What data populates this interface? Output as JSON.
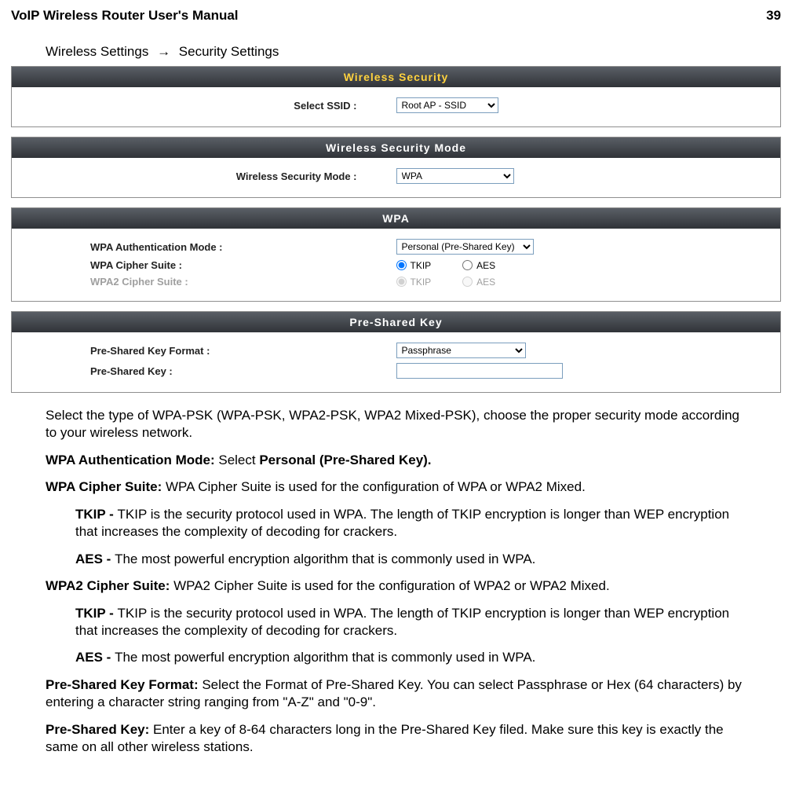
{
  "doc": {
    "title": "VoIP Wireless Router User's Manual",
    "page_number": "39"
  },
  "breadcrumb": {
    "item1": "Wireless Settings",
    "arrow": "→",
    "item2": "Security Settings"
  },
  "panel1": {
    "title": "Wireless Security",
    "ssid_label": "Select SSID :",
    "ssid_value": "Root AP - SSID"
  },
  "panel2": {
    "title": "Wireless Security Mode",
    "mode_label": "Wireless Security Mode :",
    "mode_value": "WPA"
  },
  "panel3": {
    "title": "WPA",
    "auth_label": "WPA Authentication Mode :",
    "auth_value": "Personal (Pre-Shared Key)",
    "wpa_cipher_label": "WPA Cipher Suite :",
    "wpa2_cipher_label": "WPA2 Cipher Suite :",
    "tkip": "TKIP",
    "aes": "AES"
  },
  "panel4": {
    "title": "Pre-Shared Key",
    "format_label": "Pre-Shared Key Format :",
    "format_value": "Passphrase",
    "key_label": "Pre-Shared Key :",
    "key_value": ""
  },
  "text": {
    "p1": "Select the type of WPA-PSK (WPA-PSK, WPA2-PSK, WPA2 Mixed-PSK), choose the proper security mode according to your wireless network.",
    "p2a": "WPA Authentication Mode: ",
    "p2b": "Select ",
    "p2c": "Personal (Pre-Shared Key).",
    "p3a": "WPA Cipher Suite: ",
    "p3b": "WPA Cipher Suite is used for the configuration of WPA or WPA2 Mixed.",
    "p4a": "TKIP - ",
    "p4b": "TKIP is the security protocol used in WPA. The length of TKIP encryption is longer than WEP encryption that increases the complexity of decoding for crackers.",
    "p5a": "AES - ",
    "p5b": "The most powerful encryption algorithm that is commonly used in WPA.",
    "p6a": "WPA2 Cipher Suite: ",
    "p6b": "WPA2 Cipher Suite is used for the configuration of WPA2 or WPA2 Mixed.",
    "p7a": "TKIP - ",
    "p7b": " TKIP is the security protocol used in WPA. The length of TKIP encryption is longer than WEP encryption that increases the complexity of decoding for crackers.",
    "p8a": "AES - ",
    "p8b": " The most powerful encryption algorithm that is commonly used in WPA.",
    "p9a": "Pre-Shared Key Format: ",
    "p9b": "Select the Format of Pre-Shared Key. You can select Passphrase or Hex (64 characters) by entering a character string ranging from \"A-Z\" and \"0-9\".",
    "p10a": "Pre-Shared Key: ",
    "p10b": "Enter a key of 8-64 characters long in the Pre-Shared Key filed. Make sure this key is exactly the same on all other wireless stations."
  }
}
